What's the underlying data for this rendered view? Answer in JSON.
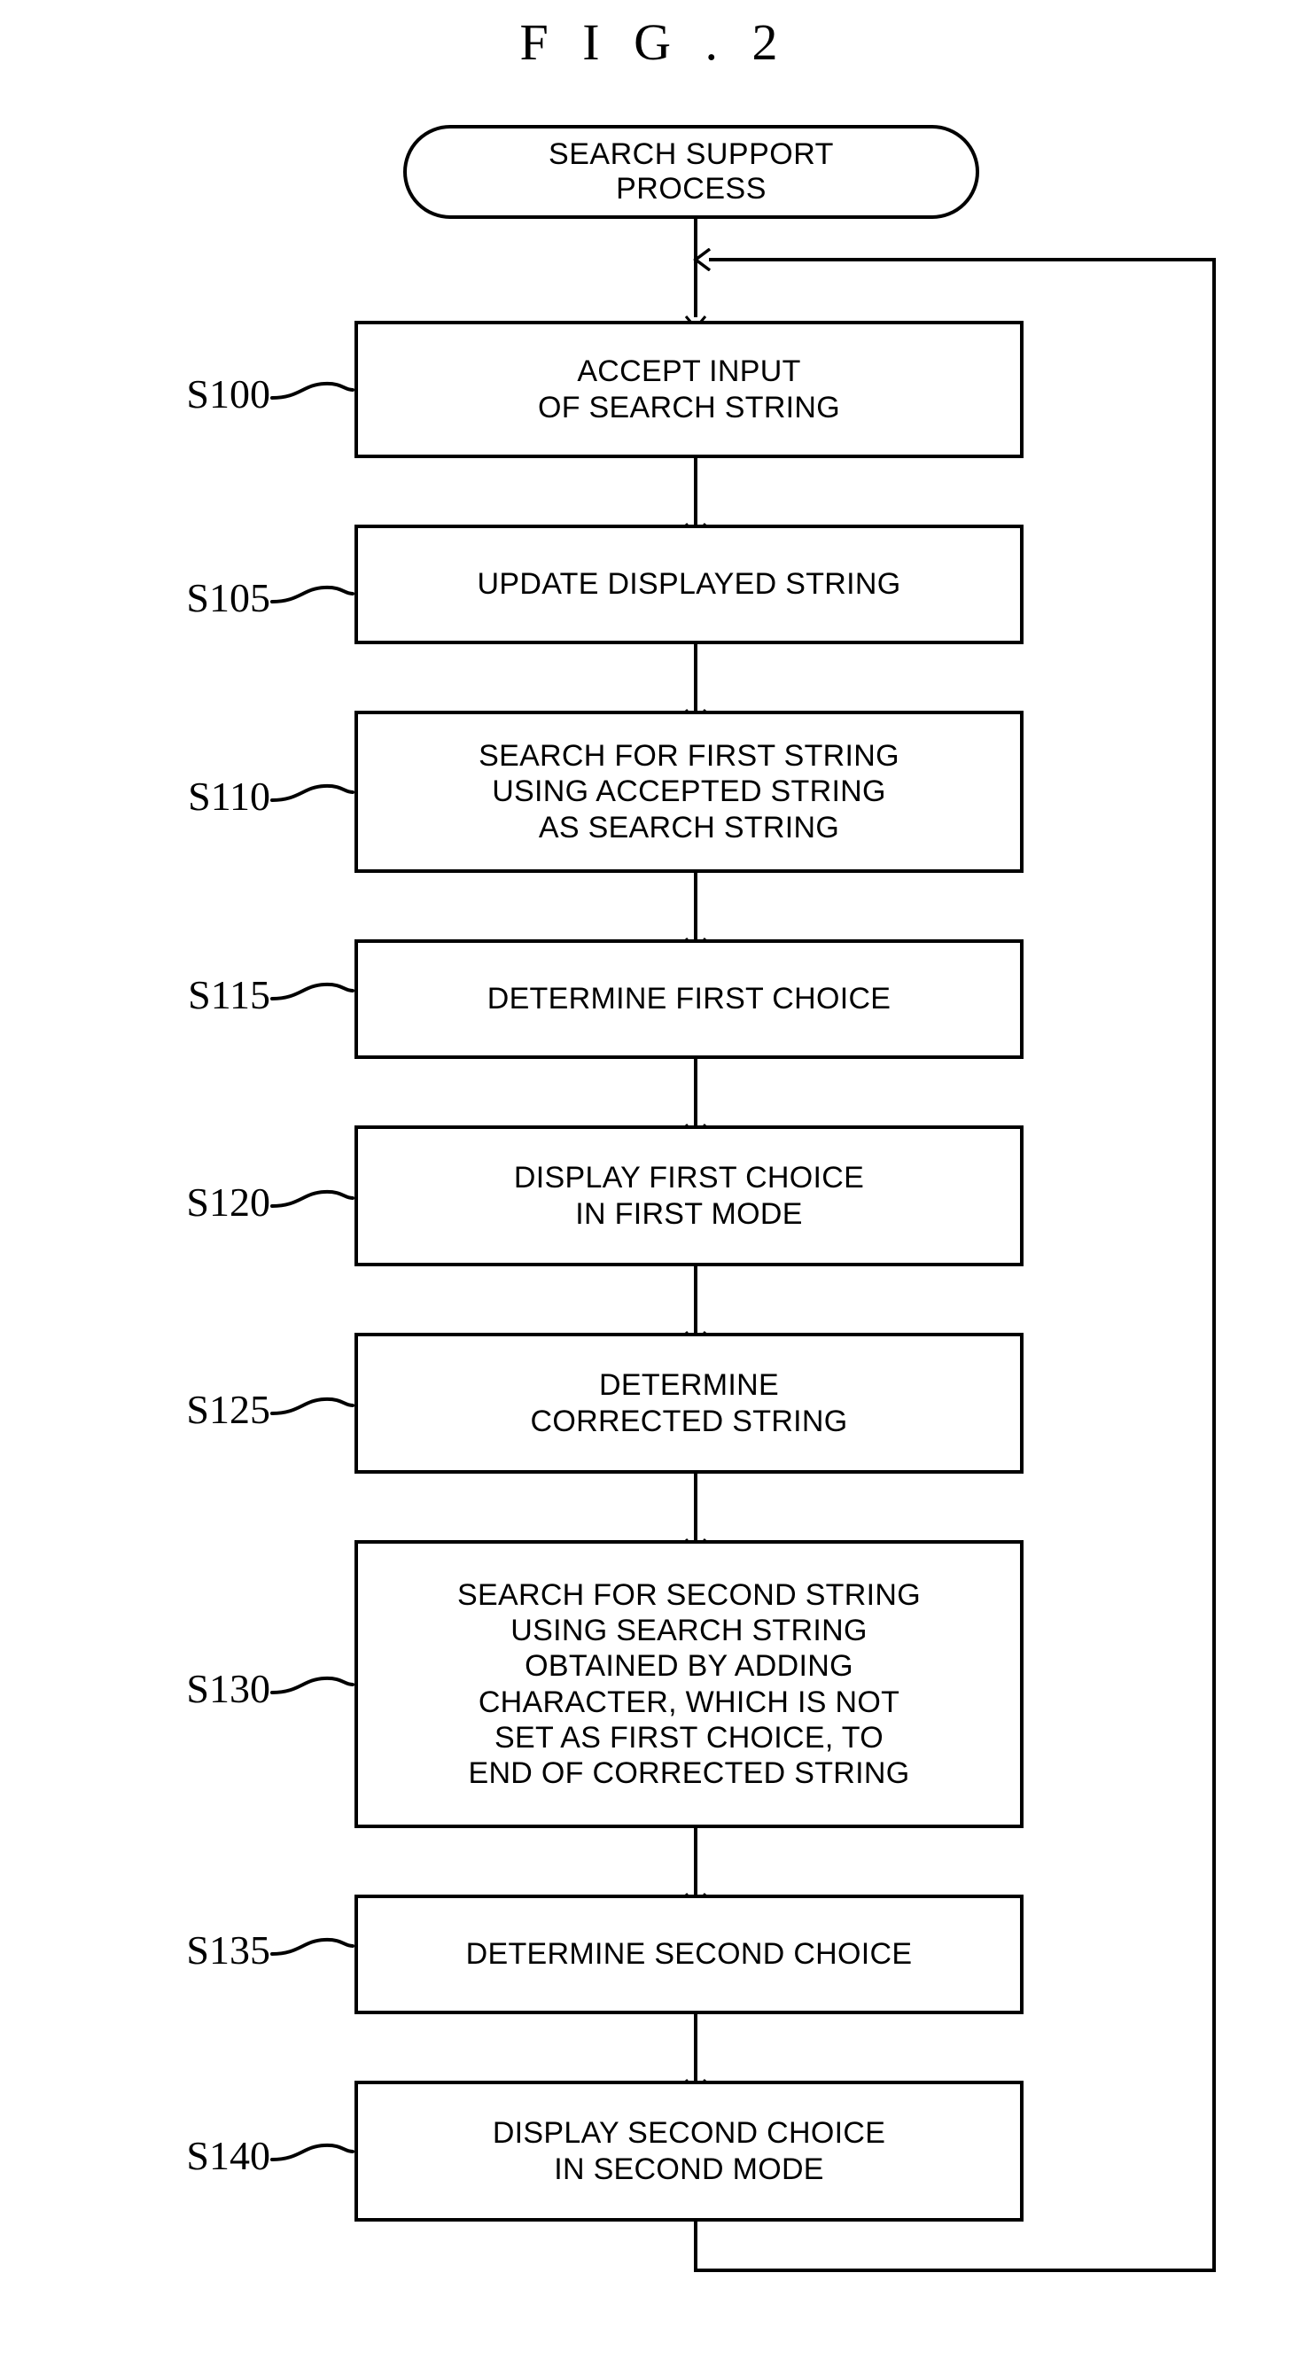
{
  "figure": {
    "title": "F I G . 2"
  },
  "flowchart": {
    "type": "flowchart",
    "orientation": "top-to-bottom",
    "terminal": {
      "id": "start",
      "shape": "rounded-terminal",
      "text": "SEARCH SUPPORT\nPROCESS"
    },
    "steps": [
      {
        "ref": "S100",
        "shape": "process",
        "text": "ACCEPT INPUT\nOF SEARCH STRING"
      },
      {
        "ref": "S105",
        "shape": "process",
        "text": "UPDATE DISPLAYED STRING"
      },
      {
        "ref": "S110",
        "shape": "process",
        "text": "SEARCH FOR FIRST STRING\nUSING ACCEPTED STRING\nAS SEARCH STRING"
      },
      {
        "ref": "S115",
        "shape": "process",
        "text": "DETERMINE FIRST CHOICE"
      },
      {
        "ref": "S120",
        "shape": "process",
        "text": "DISPLAY FIRST CHOICE\nIN FIRST MODE"
      },
      {
        "ref": "S125",
        "shape": "process",
        "text": "DETERMINE\nCORRECTED STRING"
      },
      {
        "ref": "S130",
        "shape": "process",
        "text": "SEARCH FOR SECOND STRING\nUSING SEARCH STRING\nOBTAINED BY ADDING\nCHARACTER, WHICH IS NOT\nSET AS FIRST CHOICE, TO\nEND OF CORRECTED STRING"
      },
      {
        "ref": "S135",
        "shape": "process",
        "text": "DETERMINE SECOND CHOICE"
      },
      {
        "ref": "S140",
        "shape": "process",
        "text": "DISPLAY SECOND CHOICE\nIN SECOND MODE"
      }
    ],
    "edges": [
      {
        "from": "start",
        "to": "S100",
        "style": "arrow-down"
      },
      {
        "from": "S100",
        "to": "S105",
        "style": "arrow-down"
      },
      {
        "from": "S105",
        "to": "S110",
        "style": "arrow-down"
      },
      {
        "from": "S110",
        "to": "S115",
        "style": "arrow-down"
      },
      {
        "from": "S115",
        "to": "S120",
        "style": "arrow-down"
      },
      {
        "from": "S120",
        "to": "S125",
        "style": "arrow-down"
      },
      {
        "from": "S125",
        "to": "S130",
        "style": "arrow-down"
      },
      {
        "from": "S130",
        "to": "S135",
        "style": "arrow-down"
      },
      {
        "from": "S135",
        "to": "S140",
        "style": "arrow-down"
      },
      {
        "from": "S140",
        "to": "S100",
        "style": "feedback-loop-right",
        "label": ""
      }
    ],
    "colors": {
      "stroke": "#000000",
      "fill": "#ffffff",
      "text": "#000000"
    }
  }
}
